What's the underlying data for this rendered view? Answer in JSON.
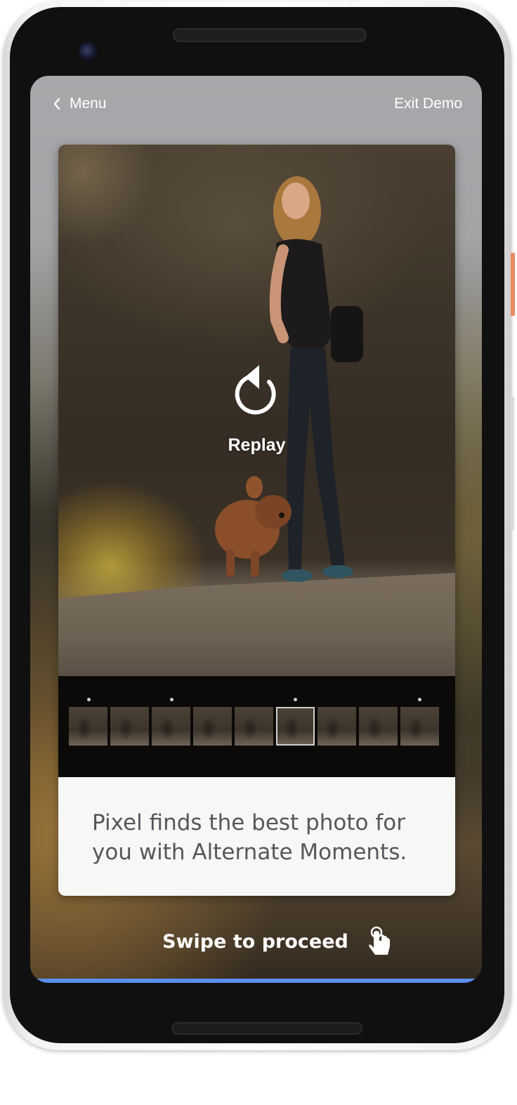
{
  "topbar": {
    "back_label": "Menu",
    "exit_label": "Exit Demo"
  },
  "photo": {
    "replay_label": "Replay"
  },
  "filmstrip": {
    "thumbnail_count": 9,
    "selected_index": 5,
    "marked_indices": [
      0,
      2,
      5,
      8
    ]
  },
  "caption": {
    "text": "Pixel finds the best photo for you with Alternate Moments."
  },
  "footer": {
    "swipe_label": "Swipe to proceed",
    "icon": "tap-hand-icon"
  },
  "colors": {
    "progress_bar": "#5b8ff0",
    "side_button": "#e98a63"
  }
}
